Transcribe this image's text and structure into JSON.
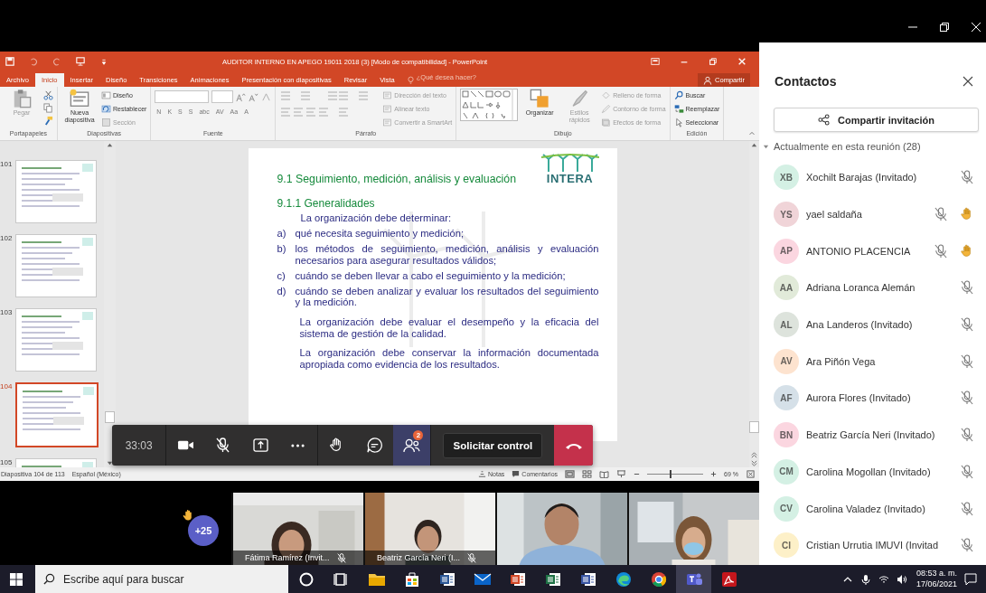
{
  "powerpoint": {
    "title": "AUDITOR INTERNO EN APEGO 19011 2018 (3) [Modo de compatibilidad] - PowerPoint",
    "tabs": [
      {
        "label": "Archivo",
        "selected": false
      },
      {
        "label": "Inicio",
        "selected": true
      },
      {
        "label": "Insertar",
        "selected": false
      },
      {
        "label": "Diseño",
        "selected": false
      },
      {
        "label": "Transiciones",
        "selected": false
      },
      {
        "label": "Animaciones",
        "selected": false
      },
      {
        "label": "Presentación con diapositivas",
        "selected": false
      },
      {
        "label": "Revisar",
        "selected": false
      },
      {
        "label": "Vista",
        "selected": false
      }
    ],
    "tell_me": "¿Qué desea hacer?",
    "share": "Compartir",
    "ribbon": [
      {
        "label": "Portapapeles",
        "large": [
          {
            "label": "Pegar",
            "kind": "paste",
            "disabled": true
          }
        ]
      },
      {
        "label": "Diapositivas",
        "large": [
          {
            "label": "Nueva diapositiva",
            "kind": "new-slide",
            "disabled": false
          }
        ],
        "small": [
          {
            "label": "Diseño",
            "kind": "layout",
            "disabled": false
          },
          {
            "label": "Restablecer",
            "kind": "reset",
            "disabled": false
          },
          {
            "label": "Sección",
            "kind": "section",
            "disabled": true
          }
        ]
      },
      {
        "label": "Fuente",
        "font_buttons": [
          "N",
          "K",
          "S",
          "S",
          "abc",
          "AV",
          "Aa",
          "A"
        ]
      },
      {
        "label": "Párrafo",
        "small": [
          {
            "label": "Dirección del texto",
            "kind": "text-direction",
            "disabled": true
          },
          {
            "label": "Alinear texto",
            "kind": "align-text",
            "disabled": true
          },
          {
            "label": "Convertir a SmartArt",
            "kind": "smartart",
            "disabled": true
          }
        ]
      },
      {
        "label": "Dibujo",
        "large": [
          {
            "label": "Organizar",
            "kind": "arrange",
            "disabled": false
          },
          {
            "label": "Estilos rápidos",
            "kind": "quick-styles",
            "disabled": true
          }
        ],
        "small": [
          {
            "label": "Relleno de forma",
            "kind": "fill",
            "disabled": true
          },
          {
            "label": "Contorno de forma",
            "kind": "outline",
            "disabled": true
          },
          {
            "label": "Efectos de forma",
            "kind": "effects",
            "disabled": true
          }
        ]
      },
      {
        "label": "Edición",
        "small": [
          {
            "label": "Buscar",
            "kind": "find",
            "disabled": false
          },
          {
            "label": "Reemplazar",
            "kind": "replace",
            "disabled": false
          },
          {
            "label": "Seleccionar",
            "kind": "select",
            "disabled": false
          }
        ]
      }
    ],
    "thumbnails": [
      {
        "number": "101",
        "selected": false
      },
      {
        "number": "102",
        "selected": false
      },
      {
        "number": "103",
        "selected": false
      },
      {
        "number": "104",
        "selected": true
      },
      {
        "number": "105",
        "selected": false
      }
    ],
    "slide": {
      "title": "9.1 Seguimiento, medición, análisis y evaluación",
      "logo": "INTERA",
      "subtitle": "9.1.1  Generalidades",
      "lead": "La organización debe determinar:",
      "items": [
        {
          "marker": "a)",
          "text": "qué necesita seguimiento y medición;"
        },
        {
          "marker": "b)",
          "text": "los métodos de seguimiento, medición, análisis y evaluación necesarios para  asegurar resultados válidos;"
        },
        {
          "marker": "c)",
          "text": "cuándo se deben llevar a cabo el seguimiento y la medición;"
        },
        {
          "marker": "d)",
          "text": "cuándo se deben analizar y evaluar los resultados del seguimiento y la medición."
        }
      ],
      "paragraphs": [
        "La organización debe evaluar el desempeño y la eficacia del sistema de gestión de la calidad.",
        "La organización debe conservar la información documentada apropiada como evidencia de los resultados."
      ]
    },
    "status": {
      "slide_info": "Diapositiva 104 de 113",
      "language": "Español (México)",
      "notes": "Notas",
      "comments": "Comentarios",
      "zoom": "69 %",
      "level": 0.4
    }
  },
  "meeting_bar": {
    "timer": "33:03",
    "controls": [
      {
        "kind": "camera",
        "selected": false
      },
      {
        "kind": "mic-off",
        "selected": false
      },
      {
        "kind": "share",
        "selected": false
      },
      {
        "kind": "more",
        "selected": false
      },
      {
        "kind": "hand",
        "selected": false
      },
      {
        "kind": "chat",
        "selected": false
      },
      {
        "kind": "people",
        "selected": true,
        "badge": "2"
      }
    ],
    "request_control": "Solicitar control"
  },
  "video": {
    "overflow": "+25",
    "tiles": [
      {
        "kind": "labeled",
        "name": "Fátima Ramírez (Invit...",
        "muted": true
      },
      {
        "kind": "labeled",
        "name": "Beatriz García Neri (I...",
        "muted": true
      },
      {
        "kind": "picture"
      },
      {
        "kind": "picture"
      }
    ]
  },
  "contacts": {
    "title": "Contactos",
    "share_button": "Compartir invitación",
    "section": {
      "label": "Actualmente en esta reunión (28)",
      "expanded": true
    },
    "participants": [
      {
        "initials": "XB",
        "name": "Xochilt Barajas (Invitado)",
        "color": "#d4f0e4",
        "muted": true,
        "hand_raised": false
      },
      {
        "initials": "YS",
        "name": "yael saldaña",
        "color": "#f0d4d8",
        "muted": true,
        "hand_raised": true
      },
      {
        "initials": "AP",
        "name": "ANTONIO PLACENCIA",
        "color": "#fbd6e0",
        "muted": true,
        "hand_raised": true
      },
      {
        "initials": "AA",
        "name": "Adriana Loranca Alemán",
        "color": "#e1ead9",
        "muted": true,
        "hand_raised": false
      },
      {
        "initials": "AL",
        "name": "Ana Landeros (Invitado)",
        "color": "#dde3dc",
        "muted": true,
        "hand_raised": false
      },
      {
        "initials": "AV",
        "name": "Ara Piñón Vega",
        "color": "#fde3cf",
        "muted": true,
        "hand_raised": false
      },
      {
        "initials": "AF",
        "name": "Aurora Flores (Invitado)",
        "color": "#d5e0e8",
        "muted": true,
        "hand_raised": false
      },
      {
        "initials": "BN",
        "name": "Beatriz García Neri (Invitado)",
        "color": "#fbd6e0",
        "muted": true,
        "hand_raised": false
      },
      {
        "initials": "CM",
        "name": "Carolina Mogollan (Invitado)",
        "color": "#d4f0e4",
        "muted": true,
        "hand_raised": false
      },
      {
        "initials": "CV",
        "name": "Carolina Valadez (Invitado)",
        "color": "#d4f0e4",
        "muted": true,
        "hand_raised": false
      },
      {
        "initials": "CI",
        "name": "Cristian Urrutia IMUVI (Invitad",
        "color": "#fdf0c8",
        "muted": true,
        "hand_raised": false
      }
    ]
  },
  "taskbar": {
    "search_placeholder": "Escribe aquí para buscar",
    "apps": [
      {
        "kind": "cortana",
        "selected": false
      },
      {
        "kind": "task-view",
        "selected": false
      },
      {
        "kind": "explorer",
        "selected": false
      },
      {
        "kind": "store",
        "selected": false
      },
      {
        "kind": "word",
        "selected": false
      },
      {
        "kind": "mail",
        "selected": false
      },
      {
        "kind": "powerpoint",
        "selected": false
      },
      {
        "kind": "excel",
        "selected": false
      },
      {
        "kind": "visio",
        "selected": false
      },
      {
        "kind": "edge",
        "selected": false
      },
      {
        "kind": "chrome",
        "selected": false
      },
      {
        "kind": "teams",
        "selected": true
      },
      {
        "kind": "acrobat",
        "selected": false
      }
    ],
    "time": "08:53 a. m.",
    "date": "17/06/2021"
  }
}
